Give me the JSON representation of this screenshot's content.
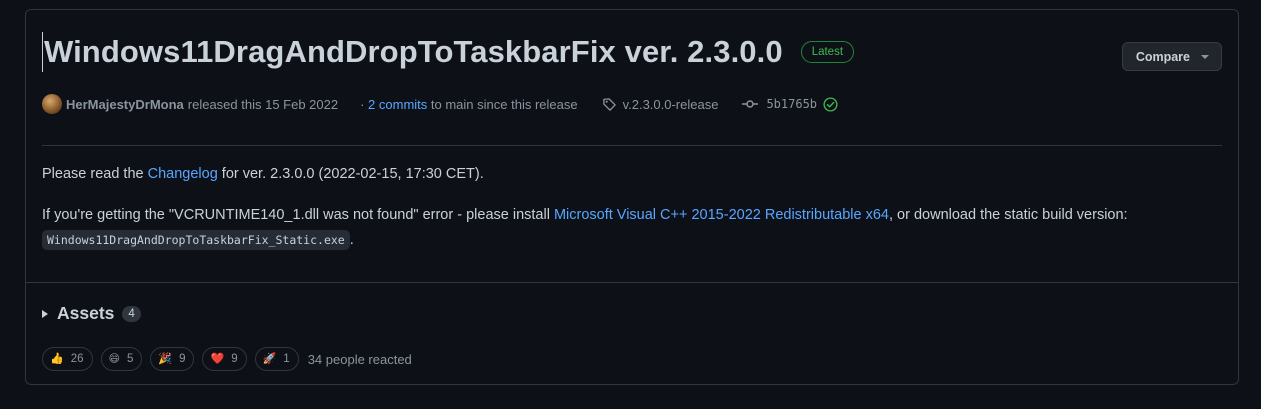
{
  "release": {
    "title": "Windows11DragAndDropToTaskbarFix ver. 2.3.0.0",
    "badge": "Latest",
    "compare_label": "Compare"
  },
  "meta": {
    "author": "HerMajestyDrMona",
    "released_text": "released this 15 Feb 2022",
    "commits_prefix": "· ",
    "commits_link": "2 commits",
    "commits_suffix": " to main since this release",
    "tag": "v.2.3.0.0-release",
    "commit_sha": "5b1765b"
  },
  "body": {
    "p1_before": "Please read the ",
    "p1_link": "Changelog",
    "p1_after": " for ver. 2.3.0.0 (2022-02-15, 17:30 CET).",
    "p2_before": "If you're getting the \"VCRUNTIME140_1.dll was not found\" error - please install ",
    "p2_link": "Microsoft Visual C++ 2015-2022 Redistributable x64",
    "p2_middle": ", or download the static build version: ",
    "p2_code": "Windows11DragAndDropToTaskbarFix_Static.exe",
    "p2_after": "."
  },
  "assets": {
    "label": "Assets",
    "count": "4"
  },
  "reactions": {
    "items": [
      {
        "icon": "thumbs-up-icon",
        "emoji": "👍",
        "count": "26"
      },
      {
        "icon": "laugh-icon",
        "emoji": "😄",
        "count": "5"
      },
      {
        "icon": "hooray-icon",
        "emoji": "🎉",
        "count": "9"
      },
      {
        "icon": "heart-icon",
        "emoji": "❤️",
        "count": "9"
      },
      {
        "icon": "rocket-icon",
        "emoji": "🚀",
        "count": "1"
      }
    ],
    "summary": "34 people reacted"
  },
  "colors": {
    "background": "#0d1117",
    "border": "#30363d",
    "text": "#c9d1d9",
    "muted": "#8b949e",
    "link": "#58a6ff",
    "success": "#3fb950"
  }
}
